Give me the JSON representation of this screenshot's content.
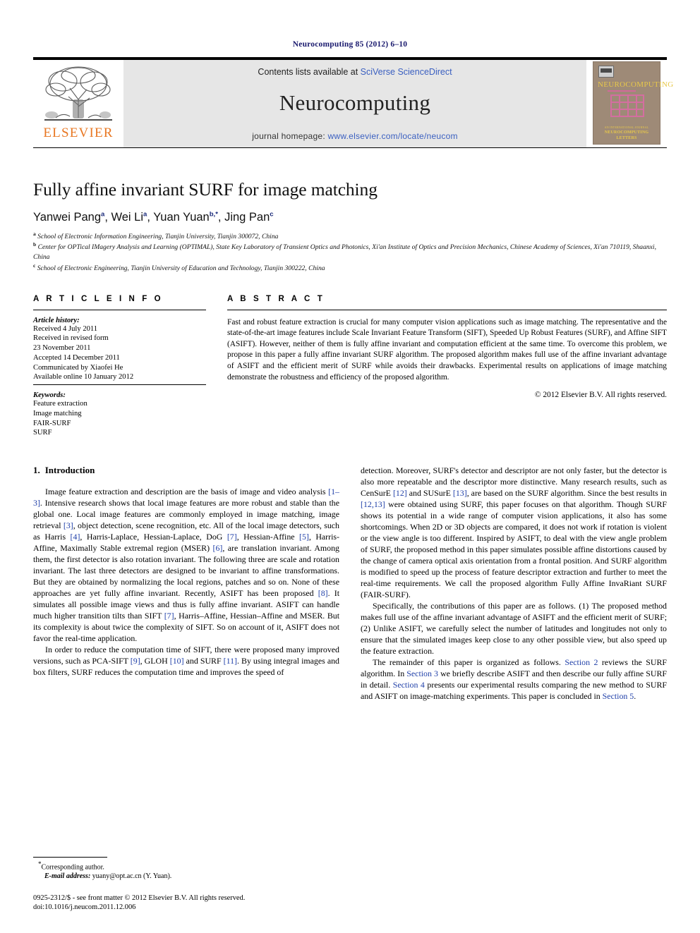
{
  "running_head": "Neurocomputing 85 (2012) 6–10",
  "masthead": {
    "contents_prefix": "Contents lists available at ",
    "contents_link": "SciVerse ScienceDirect",
    "journal_title": "Neurocomputing",
    "homepage_prefix": "journal homepage: ",
    "homepage_link": "www.elsevier.com/locate/neucom",
    "publisher_wordmark": "ELSEVIER",
    "cover": {
      "title": "NEUROCOMPUTING",
      "foot_small": "AN INTERNATIONAL JOURNAL",
      "foot_line1": "INCORPORATING",
      "foot_line2": "NEUROCOMPUTING",
      "foot_line3": "LETTERS"
    },
    "link_color": "#3a5fc0",
    "band_color": "#e6e6e6",
    "elsevier_orange": "#E87722"
  },
  "article": {
    "title": "Fully affine invariant SURF for image matching",
    "authors": [
      {
        "name": "Yanwei Pang",
        "marks": "a",
        "sep": ", "
      },
      {
        "name": "Wei Li",
        "marks": "a",
        "sep": ", "
      },
      {
        "name": "Yuan Yuan",
        "marks": "b,*",
        "sep": ", "
      },
      {
        "name": "Jing Pan",
        "marks": "c",
        "sep": ""
      }
    ],
    "affiliations": [
      {
        "mark": "a",
        "text": "School of Electronic Information Engineering, Tianjin University, Tianjin 300072, China"
      },
      {
        "mark": "b",
        "text": "Center for OPTical IMagery Analysis and Learning (OPTIMAL), State Key Laboratory of Transient Optics and Photonics, Xi'an Institute of Optics and Precision Mechanics, Chinese Academy of Sciences, Xi'an 710119, Shaanxi, China"
      },
      {
        "mark": "c",
        "text": "School of Electronic Engineering, Tianjin University of Education and Technology, Tianjin 300222, China"
      }
    ]
  },
  "article_info": {
    "heading": "A R T I C L E   I N F O",
    "history_label": "Article history:",
    "history": [
      "Received 4 July 2011",
      "Received in revised form",
      "23 November 2011",
      "Accepted 14 December 2011",
      "Communicated by Xiaofei He",
      "Available online 10 January 2012"
    ],
    "keywords_label": "Keywords:",
    "keywords": [
      "Feature extraction",
      "Image matching",
      "FAIR-SURF",
      "SURF"
    ]
  },
  "abstract": {
    "heading": "A B S T R A C T",
    "text": "Fast and robust feature extraction is crucial for many computer vision applications such as image matching. The representative and the state-of-the-art image features include Scale Invariant Feature Transform (SIFT), Speeded Up Robust Features (SURF), and Affine SIFT (ASIFT). However, neither of them is fully affine invariant and computation efficient at the same time. To overcome this problem, we propose in this paper a fully affine invariant SURF algorithm. The proposed algorithm makes full use of the affine invariant advantage of ASIFT and the efficient merit of SURF while avoids their drawbacks. Experimental results on applications of image matching demonstrate the robustness and efficiency of the proposed algorithm.",
    "copyright": "© 2012 Elsevier B.V. All rights reserved."
  },
  "introduction": {
    "number": "1.",
    "title": "Introduction",
    "left_paragraphs": [
      "Image feature extraction and description are the basis of image and video analysis [1–3]. Intensive research shows that local image features are more robust and stable than the global one. Local image features are commonly employed in image matching, image retrieval [3], object detection, scene recognition, etc. All of the local image detectors, such as Harris [4], Harris-Laplace, Hessian-Laplace, DoG [7], Hessian-Affine [5], Harris-Affine, Maximally Stable extremal region (MSER) [6], are translation invariant. Among them, the first detector is also rotation invariant. The following three are scale and rotation invariant. The last three detectors are designed to be invariant to affine transformations. But they are obtained by normalizing the local regions, patches and so on. None of these approaches are yet fully affine invariant. Recently, ASIFT has been proposed [8]. It simulates all possible image views and thus is fully affine invariant. ASIFT can handle much higher transition tilts than SIFT [7], Harris–Affine, Hessian–Affine and MSER. But its complexity is about twice the complexity of SIFT. So on account of it, ASIFT does not favor the real-time application.",
      "In order to reduce the computation time of SIFT, there were proposed many improved versions, such as PCA-SIFT [9], GLOH [10] and SURF [11]. By using integral images and box filters, SURF reduces the computation time and improves the speed of"
    ],
    "right_paragraphs": [
      "detection. Moreover, SURF's detector and descriptor are not only faster, but the detector is also more repeatable and the descriptor more distinctive. Many research results, such as CenSurE [12] and SUSurE [13], are based on the SURF algorithm. Since the best results in [12,13] were obtained using SURF, this paper focuses on that algorithm. Though SURF shows its potential in a wide range of computer vision applications, it also has some shortcomings. When 2D or 3D objects are compared, it does not work if rotation is violent or the view angle is too different. Inspired by ASIFT, to deal with the view angle problem of SURF, the proposed method in this paper simulates possible affine distortions caused by the change of camera optical axis orientation from a frontal position. And SURF algorithm is modified to speed up the process of feature descriptor extraction and further to meet the real-time requirements. We call the proposed algorithm Fully Affine InvaRiant SURF (FAIR-SURF).",
      "Specifically, the contributions of this paper are as follows. (1) The proposed method makes full use of the affine invariant advantage of ASIFT and the efficient merit of SURF; (2) Unlike ASIFT, we carefully select the number of latitudes and longitudes not only to ensure that the simulated images keep close to any other possible view, but also speed up the feature extraction.",
      "The remainder of this paper is organized as follows. Section 2 reviews the SURF algorithm. In Section 3 we briefly describe ASIFT and then describe our fully affine SURF in detail. Section 4 presents our experimental results comparing the new method to SURF and ASIFT on image-matching experiments. This paper is concluded in Section 5."
    ]
  },
  "footnotes": {
    "corresponding_mark": "*",
    "corresponding_text": "Corresponding author.",
    "email_label": "E-mail address:",
    "email_value": "yuany@opt.ac.cn (Y. Yuan)."
  },
  "footer": {
    "issn_line": "0925-2312/$ - see front matter © 2012 Elsevier B.V. All rights reserved.",
    "doi_line": "doi:10.1016/j.neucom.2011.12.006"
  }
}
